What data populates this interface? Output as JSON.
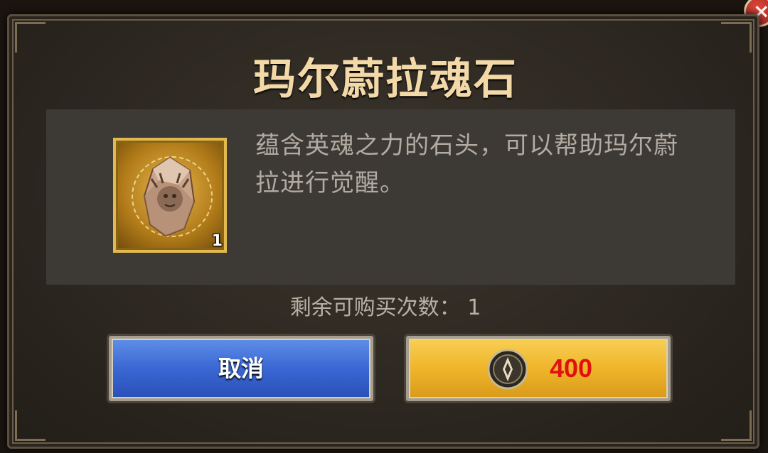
{
  "dialog": {
    "title": "玛尔蔚拉魂石",
    "item": {
      "icon": "soul-stone-icon",
      "count": "1",
      "description": "蕴含英魂之力的石头，可以帮助玛尔蔚拉进行觉醒。"
    },
    "remaining_label": "剩余可购买次数： 1",
    "cancel_label": "取消",
    "buy": {
      "currency_icon": "rune-coin-icon",
      "price": "400"
    },
    "close_icon": "close-icon"
  },
  "colors": {
    "title": "#f3d9a8",
    "price": "#e01010",
    "cancel_button": "#3a67d3",
    "buy_button": "#f0b52a"
  }
}
